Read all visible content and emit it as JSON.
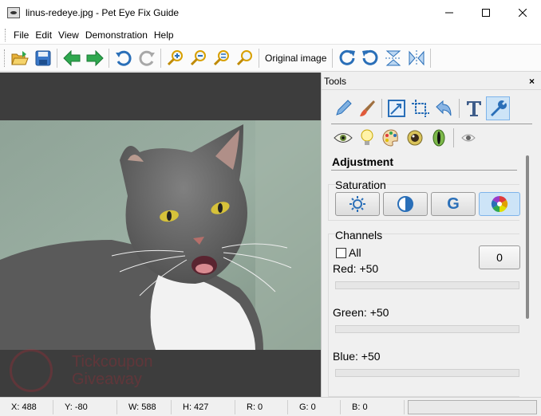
{
  "window": {
    "title": "linus-redeye.jpg - Pet Eye Fix Guide",
    "minimize_icon": "minimize-icon",
    "maximize_icon": "maximize-icon",
    "close_icon": "close-icon"
  },
  "menu": [
    "File",
    "Edit",
    "View",
    "Demonstration",
    "Help"
  ],
  "toolbar": {
    "buttons": [
      "open-icon",
      "save-icon",
      "back-arrow-icon",
      "forward-arrow-icon",
      "undo-icon",
      "redo-icon",
      "zoom-in-icon",
      "zoom-out-icon",
      "zoom-fit-icon",
      "zoom-actual-icon"
    ],
    "original_image_label": "Original image",
    "transform_buttons": [
      "rotate-cw-icon",
      "rotate-ccw-icon",
      "flip-vertical-icon",
      "flip-horizontal-icon"
    ]
  },
  "tools": {
    "title": "Tools",
    "close_label": "×",
    "row1": [
      "pencil-icon",
      "brush-icon",
      "resize-icon",
      "crop-icon",
      "undo-arrow-icon",
      "text-icon",
      "wrench-icon"
    ],
    "row1_active": "wrench-icon",
    "row2": [
      "eye-icon",
      "lightbulb-icon",
      "palette-icon",
      "redeye-icon",
      "cat-eye-icon",
      "eye-small-icon"
    ],
    "adjustment_title": "Adjustment",
    "saturation": {
      "label": "Saturation",
      "buttons": [
        "brightness-icon",
        "contrast-icon",
        "gamma-icon",
        "color-wheel-icon"
      ],
      "gamma_letter": "G",
      "active": "color-wheel-icon"
    },
    "channels": {
      "label": "Channels",
      "all_label": "All",
      "all_checked": false,
      "value_box": "0",
      "items": [
        {
          "label": "Red: +50"
        },
        {
          "label": "Green: +50"
        },
        {
          "label": "Blue: +50"
        }
      ]
    }
  },
  "status": {
    "x": "X: 488",
    "y": "Y: -80",
    "w": "W: 588",
    "h": "H: 427",
    "r": "R: 0",
    "g": "G: 0",
    "b": "B: 0"
  },
  "watermark": {
    "line1": "Tickcoupon",
    "line2": "Giveaway"
  },
  "colors": {
    "active_highlight": "#cde4f7",
    "canvas_bg": "#3d3d3d",
    "arrow_green": "#2fa84f",
    "icon_blue": "#2a6fb8"
  }
}
